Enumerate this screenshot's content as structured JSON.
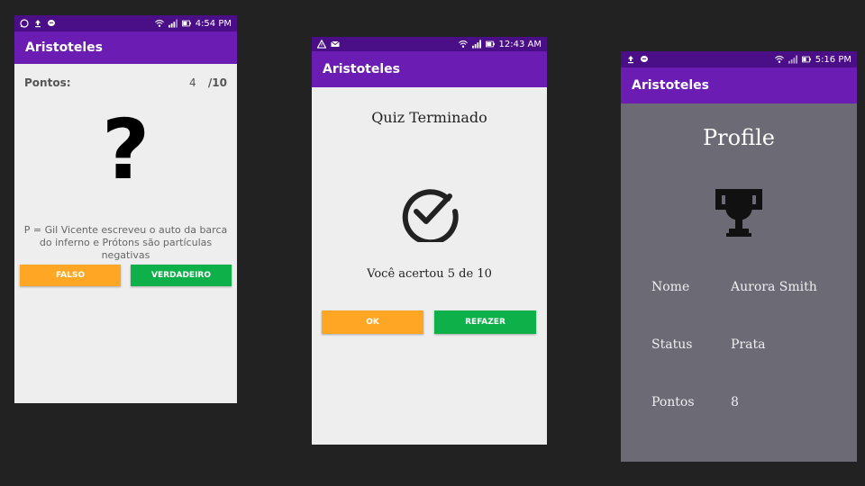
{
  "colors": {
    "background": "#222222",
    "status_bar": "#4a0e86",
    "app_bar": "#6a1cb3",
    "screen_light": "#eeeeee",
    "screen_profile": "#6c6b75",
    "button_orange": "#ffa724",
    "button_green": "#0eb04a"
  },
  "phone1": {
    "status": {
      "time": "4:54 PM",
      "left_icons": [
        "whatsapp-icon",
        "upload-icon",
        "chat-icon"
      ],
      "right_icons": [
        "wifi-icon",
        "signal-icon",
        "battery-icon"
      ]
    },
    "app_title": "Aristoteles",
    "score_label": "Pontos:",
    "score_value": "4",
    "score_total": "/10",
    "question_mark": "?",
    "question": "P = Gil Vicente escreveu o auto da barca do inferno e Prótons são partículas negativas",
    "false_button": "FALSO",
    "true_button": "VERDADEIRO"
  },
  "phone2": {
    "status": {
      "time": "12:43 AM",
      "left_icons": [
        "warning-icon",
        "mail-icon"
      ],
      "right_icons": [
        "wifi-icon",
        "signal-icon",
        "battery-icon"
      ]
    },
    "app_title": "Aristoteles",
    "title": "Quiz Terminado",
    "icon": "check-circle-icon",
    "result": "Você acertou 5 de 10",
    "ok_button": "OK",
    "redo_button": "REFAZER"
  },
  "phone3": {
    "status": {
      "time": "5:16 PM",
      "left_icons": [
        "upload-icon",
        "chat-icon"
      ],
      "right_icons": [
        "wifi-icon",
        "signal-icon",
        "battery-icon"
      ]
    },
    "app_title": "Aristoteles",
    "title": "Profile",
    "icon": "trophy-icon",
    "fields": [
      {
        "label": "Nome",
        "value": "Aurora Smith"
      },
      {
        "label": "Status",
        "value": "Prata"
      },
      {
        "label": "Pontos",
        "value": "8"
      }
    ]
  }
}
